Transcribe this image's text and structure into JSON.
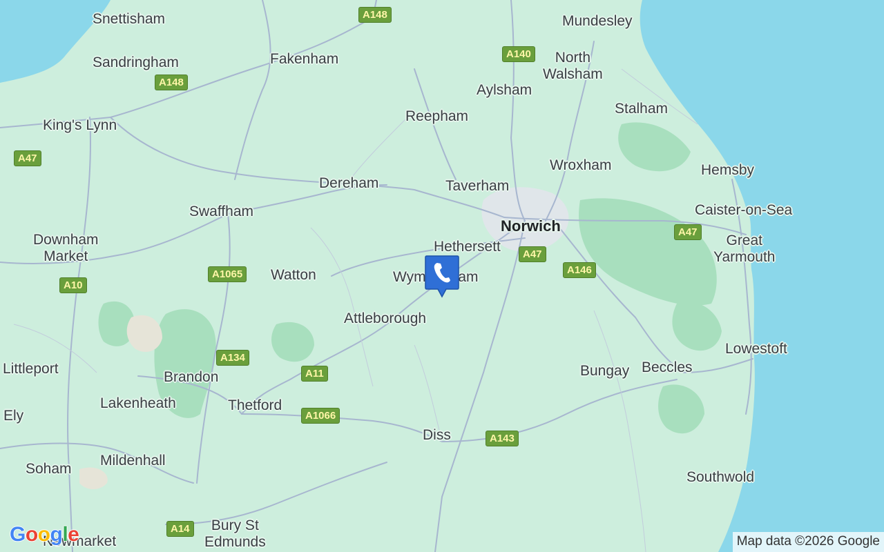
{
  "map": {
    "colors": {
      "land": "#cdeedd",
      "water": "#8bd7ea",
      "forest": "#a8dfbe",
      "road": "#a7b6cf",
      "urban": "#e0e6ea",
      "shield": "#6a9f3c"
    },
    "places": {
      "snettisham": "Snettisham",
      "sandringham": "Sandringham",
      "kings_lynn": "King's Lynn",
      "downham_market": "Downham\nMarket",
      "swaffham": "Swaffham",
      "fakenham": "Fakenham",
      "dereham": "Dereham",
      "watton": "Watton",
      "attleborough": "Attleborough",
      "wymondham": "Wymondham",
      "hethersett": "Hethersett",
      "norwich": "Norwich",
      "taverham": "Taverham",
      "reepham": "Reepham",
      "aylsham": "Aylsham",
      "mundesley": "Mundesley",
      "north_walsham": "North\nWalsham",
      "stalham": "Stalham",
      "wroxham": "Wroxham",
      "hemsby": "Hemsby",
      "caister": "Caister-on-Sea",
      "great_yarmouth": "Great\nYarmouth",
      "lowestoft": "Lowestoft",
      "beccles": "Beccles",
      "bungay": "Bungay",
      "southwold": "Southwold",
      "diss": "Diss",
      "thetford": "Thetford",
      "brandon": "Brandon",
      "lakenheath": "Lakenheath",
      "littleport": "Littleport",
      "ely": "Ely",
      "soham": "Soham",
      "mildenhall": "Mildenhall",
      "newmarket": "Newmarket",
      "bury": "Bury St\nEdmunds"
    },
    "roads": {
      "a148_n": "A148",
      "a148_w": "A148",
      "a140": "A140",
      "a47_w": "A47",
      "a10": "A10",
      "a1065": "A1065",
      "a47_c": "A47",
      "a146": "A146",
      "a47_e": "A47",
      "a134": "A134",
      "a11": "A11",
      "a1066": "A1066",
      "a143": "A143",
      "a14": "A14"
    },
    "marker": {
      "icon": "phone-icon",
      "label": "Wymondham"
    },
    "logo": {
      "text": "Google"
    },
    "attribution": "Map data ©2026 Google"
  }
}
